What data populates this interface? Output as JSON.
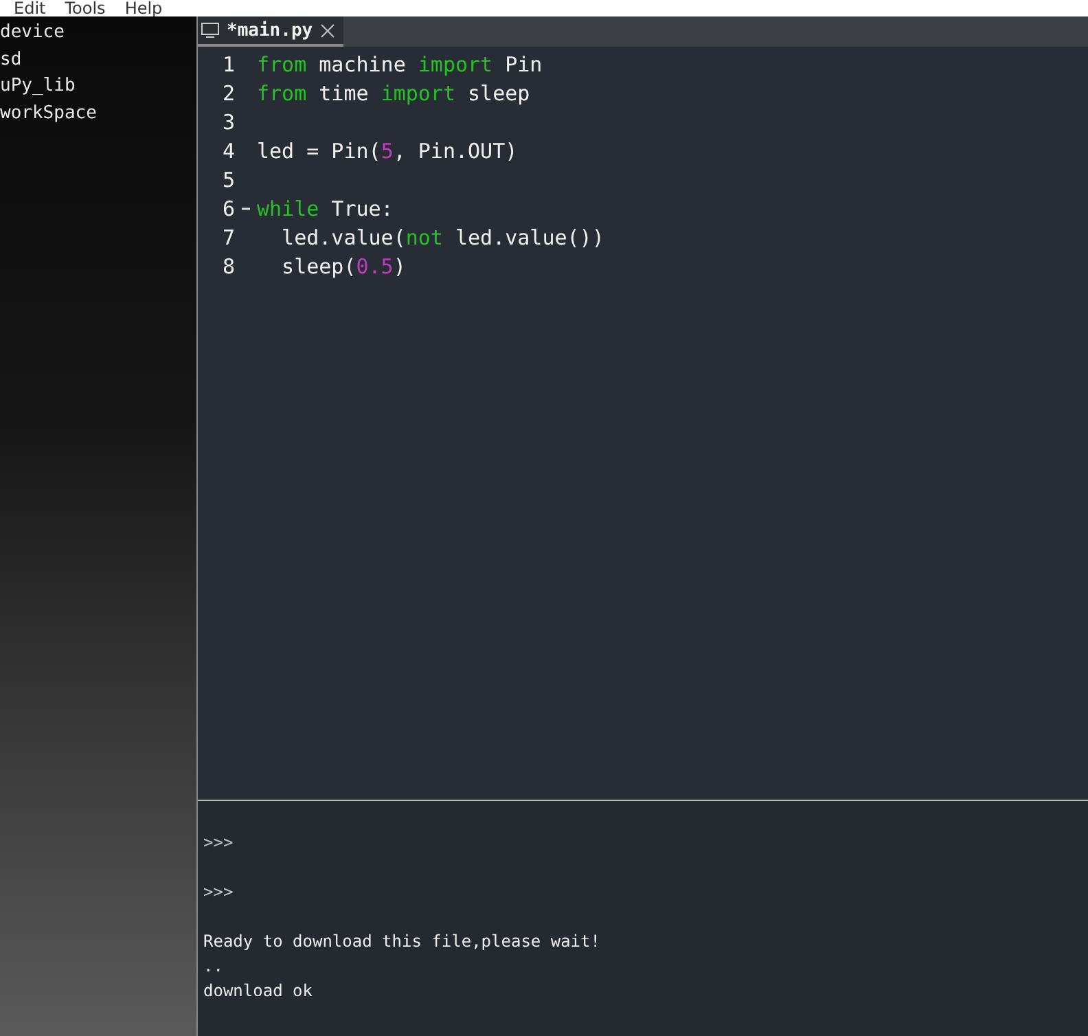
{
  "menu": [
    "Edit",
    "Tools",
    "Help"
  ],
  "sidebar": {
    "items": [
      "device",
      "sd",
      "uPy_lib",
      "workSpace"
    ]
  },
  "tabs": [
    {
      "label": "*main.py",
      "selected": true
    }
  ],
  "editor": {
    "lines": [
      {
        "number": "1",
        "folded": false,
        "tokens": [
          {
            "kind": "keyword",
            "text": "from"
          },
          {
            "kind": "plain",
            "text": " machine "
          },
          {
            "kind": "keyword",
            "text": "import"
          },
          {
            "kind": "plain",
            "text": " Pin"
          }
        ]
      },
      {
        "number": "2",
        "folded": false,
        "tokens": [
          {
            "kind": "keyword",
            "text": "from"
          },
          {
            "kind": "plain",
            "text": " time "
          },
          {
            "kind": "keyword",
            "text": "import"
          },
          {
            "kind": "plain",
            "text": " sleep"
          }
        ]
      },
      {
        "number": "3",
        "folded": false
      },
      {
        "number": "4",
        "folded": false,
        "tokens": [
          {
            "kind": "plain",
            "text": "led = Pin("
          },
          {
            "kind": "number",
            "text": "5"
          },
          {
            "kind": "plain",
            "text": ", Pin.OUT)"
          }
        ]
      },
      {
        "number": "5",
        "folded": false
      },
      {
        "number": "6",
        "folded": true,
        "tokens": [
          {
            "kind": "keyword",
            "text": "while"
          },
          {
            "kind": "plain",
            "text": " True:"
          }
        ]
      },
      {
        "number": "7",
        "folded": false,
        "tokens": [
          {
            "kind": "plain",
            "text": "  led.value("
          },
          {
            "kind": "keyword",
            "text": "not"
          },
          {
            "kind": "plain",
            "text": " led.value())"
          }
        ]
      },
      {
        "number": "8",
        "folded": false,
        "tokens": [
          {
            "kind": "plain",
            "text": "  sleep("
          },
          {
            "kind": "number",
            "text": "0.5"
          },
          {
            "kind": "plain",
            "text": ")"
          }
        ]
      }
    ]
  },
  "console": {
    "lines": [
      {
        "kind": "prompt",
        "text": ">>>"
      },
      {
        "kind": "prompt",
        "text": ">>>"
      },
      {
        "kind": "output",
        "text": "Ready to download this file,please wait!"
      },
      {
        "kind": "output",
        "text": ".."
      },
      {
        "kind": "output",
        "text": "download ok"
      }
    ]
  }
}
